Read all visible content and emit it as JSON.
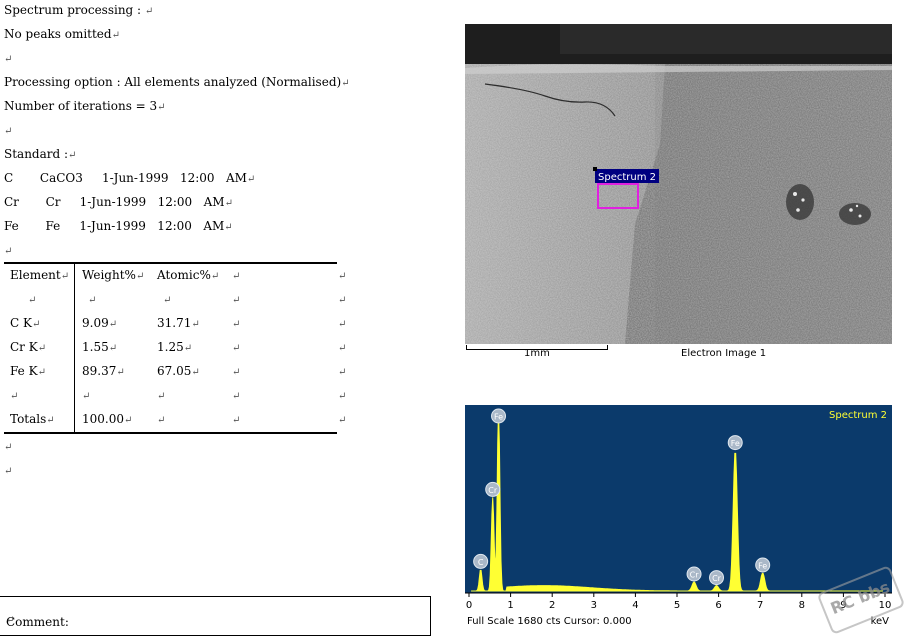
{
  "report": {
    "lines": [
      "Spectrum processing :",
      "No peaks omitted",
      "",
      "Processing option : All elements analyzed (Normalised)",
      "Number of iterations = 3",
      "",
      "Standard :",
      "C       CaCO3     1-Jun-1999   12:00   AM",
      "Cr       Cr     1-Jun-1999   12:00   AM",
      "Fe       Fe     1-Jun-1999   12:00   AM",
      ""
    ],
    "paragraph_mark": "↵"
  },
  "table": {
    "headers": [
      "Element",
      "Weight%",
      "Atomic%"
    ],
    "rows": [
      [
        "C K",
        "9.09",
        "31.71"
      ],
      [
        "Cr K",
        "1.55",
        "1.25"
      ],
      [
        "Fe K",
        "89.37",
        "67.05"
      ]
    ],
    "totals": [
      "Totals",
      "100.00",
      ""
    ]
  },
  "comment_label": "Comment:",
  "image": {
    "scale_label": "1mm",
    "caption": "Electron Image 1",
    "roi_label": "Spectrum 2"
  },
  "spectrum": {
    "title": "Spectrum 2",
    "footer": "Full Scale 1680 cts Cursor: 0.000",
    "unit": "keV",
    "background": "#0b3a6b",
    "trace_color": "#ffff33",
    "x_ticks": [
      "0",
      "1",
      "2",
      "3",
      "4",
      "5",
      "6",
      "7",
      "8",
      "9",
      "10"
    ],
    "peaks": [
      {
        "label": "C",
        "kev": 0.28,
        "height": 0.12
      },
      {
        "label": "Cr",
        "kev": 0.57,
        "height": 0.52
      },
      {
        "label": "Fe",
        "kev": 0.71,
        "height": 1.0
      },
      {
        "label": "Cr",
        "kev": 5.41,
        "height": 0.05
      },
      {
        "label": "Cr",
        "kev": 5.95,
        "height": 0.03
      },
      {
        "label": "Fe",
        "kev": 6.4,
        "height": 0.78
      },
      {
        "label": "Fe",
        "kev": 7.06,
        "height": 0.1
      }
    ]
  },
  "watermark": "RC bbs"
}
